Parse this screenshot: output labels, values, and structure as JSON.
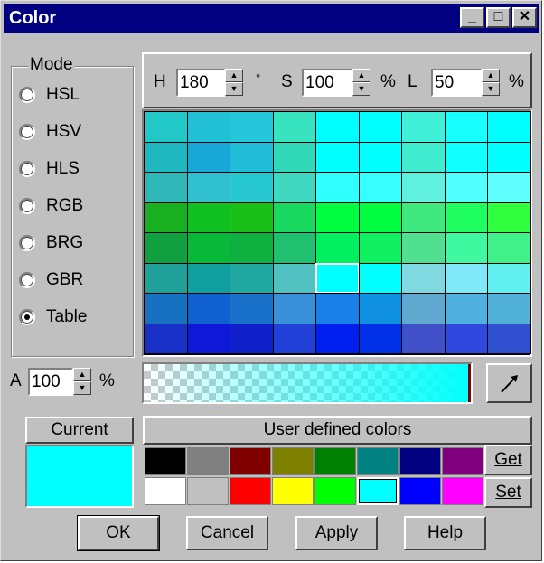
{
  "window": {
    "title": "Color",
    "minimize_symbol": "_",
    "maximize_symbol": "□",
    "close_symbol": "✕"
  },
  "mode": {
    "legend": "Mode",
    "options": [
      "HSL",
      "HSV",
      "HLS",
      "RGB",
      "BRG",
      "GBR",
      "Table"
    ],
    "selected": "Table"
  },
  "hsl": {
    "h_label": "H",
    "h_value": "180",
    "h_unit": "°",
    "s_label": "S",
    "s_value": "100",
    "s_unit": "%",
    "l_label": "L",
    "l_value": "50",
    "l_unit": "%"
  },
  "alpha": {
    "label": "A",
    "value": "100",
    "unit": "%"
  },
  "current": {
    "label": "Current",
    "color": "#00ffff"
  },
  "user_colors": {
    "title": "User defined colors",
    "row1": [
      "#000000",
      "#808080",
      "#800000",
      "#808000",
      "#008000",
      "#008080",
      "#000080",
      "#800080"
    ],
    "row2": [
      "#ffffff",
      "#c0c0c0",
      "#ff0000",
      "#ffff00",
      "#00ff00",
      "#00ffff",
      "#0000ff",
      "#ff00ff"
    ],
    "get_label": "Get",
    "set_label": "Set"
  },
  "table_grid": {
    "rows": [
      [
        "#22c8c8",
        "#22c0d6",
        "#26c6da",
        "#38e4c0",
        "#00ffff",
        "#00ffff",
        "#40f0d8",
        "#18ffff",
        "#00ffff"
      ],
      [
        "#20b8c0",
        "#18a8d8",
        "#20bcd8",
        "#30d8b8",
        "#00ffff",
        "#00ffff",
        "#40ecd0",
        "#10ffff",
        "#00ffff"
      ],
      [
        "#30b8b8",
        "#30c0d0",
        "#28c8d0",
        "#40d8c0",
        "#30ffff",
        "#38ffff",
        "#60f0e0",
        "#50ffff",
        "#60ffff"
      ],
      [
        "#18b020",
        "#10c020",
        "#18c018",
        "#18d860",
        "#00ff40",
        "#00ff40",
        "#40e880",
        "#20ff60",
        "#30ff40"
      ],
      [
        "#10a040",
        "#08b838",
        "#10b040",
        "#20c070",
        "#00f060",
        "#10f060",
        "#50e090",
        "#40f8a0",
        "#40f088"
      ],
      [
        "#20a098",
        "#10a0a0",
        "#20a8a0",
        "#50c0c0",
        "#00ffff",
        "#00ffff",
        "#80d8e0",
        "#80e8f8",
        "#60f0f0"
      ],
      [
        "#1870c0",
        "#1060d0",
        "#1870c8",
        "#3890d8",
        "#1880e8",
        "#1090e0",
        "#60a8d0",
        "#50b0e0",
        "#50b0d8"
      ],
      [
        "#1830c8",
        "#1018d8",
        "#1020c8",
        "#2040d8",
        "#0020f0",
        "#0030e8",
        "#4050c8",
        "#3048e0",
        "#3050d0"
      ]
    ],
    "selected_row": 5,
    "selected_col": 4
  },
  "picker_icon": "eyedropper-icon",
  "buttons": {
    "ok": "OK",
    "cancel": "Cancel",
    "apply": "Apply",
    "help": "Help"
  }
}
